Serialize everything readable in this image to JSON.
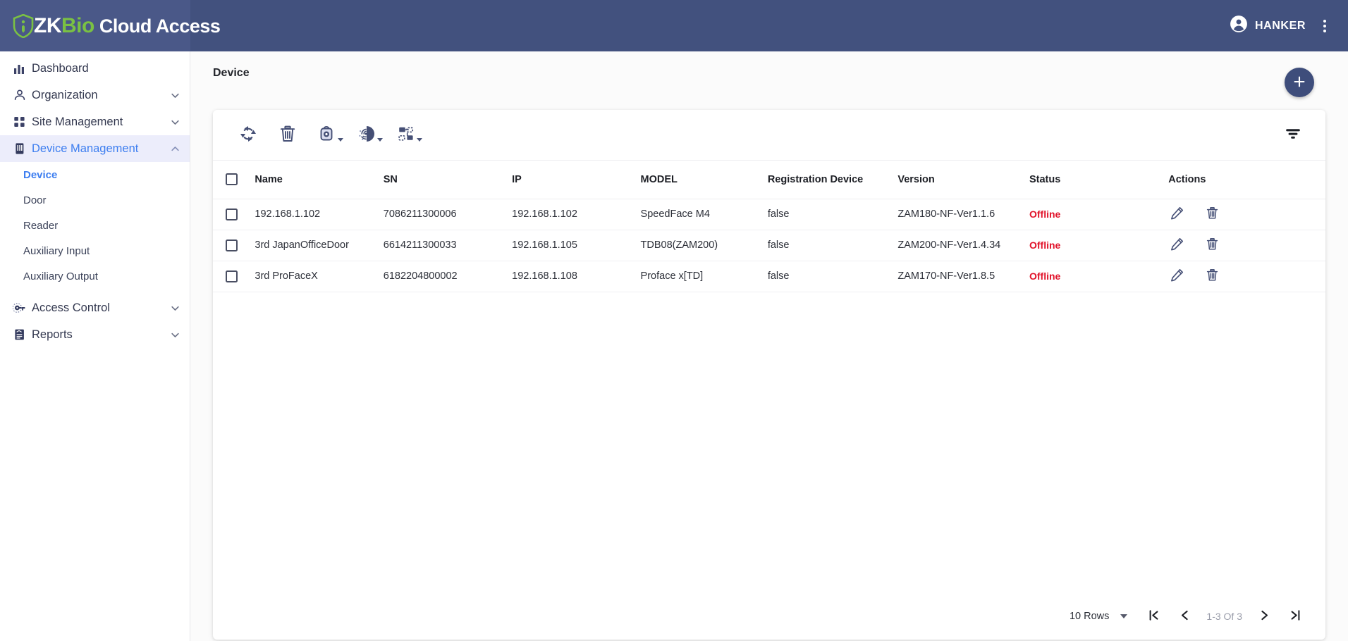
{
  "app": {
    "brand_zk": "ZK",
    "brand_bio": "Bio",
    "brand_product": "Cloud Access",
    "user_name": "HANKER"
  },
  "sidebar": {
    "items": [
      {
        "label": "Dashboard",
        "icon": "bar-chart-icon",
        "expandable": false,
        "active": false
      },
      {
        "label": "Organization",
        "icon": "person-icon",
        "expandable": true,
        "active": false
      },
      {
        "label": "Site Management",
        "icon": "grid-blocks-icon",
        "expandable": true,
        "active": false
      },
      {
        "label": "Device Management",
        "icon": "device-rack-icon",
        "expandable": true,
        "active": true
      },
      {
        "label": "Access Control",
        "icon": "key-icon",
        "expandable": true,
        "active": false
      },
      {
        "label": "Reports",
        "icon": "report-document-icon",
        "expandable": true,
        "active": false
      }
    ],
    "sub_items": [
      {
        "label": "Device",
        "active": true
      },
      {
        "label": "Door",
        "active": false
      },
      {
        "label": "Reader",
        "active": false
      },
      {
        "label": "Auxiliary Input",
        "active": false
      },
      {
        "label": "Auxiliary Output",
        "active": false
      }
    ]
  },
  "page": {
    "title": "Device",
    "add_button_label": "+"
  },
  "toolbar": {
    "buttons": [
      {
        "name": "refresh-sync-icon",
        "caret": false
      },
      {
        "name": "delete-trash-icon",
        "caret": false
      },
      {
        "name": "device-capture-icon",
        "caret": true
      },
      {
        "name": "fingerprint-gear-icon",
        "caret": true
      },
      {
        "name": "transfer-data-icon",
        "caret": true
      }
    ],
    "filter_icon": "filter-funnel-icon"
  },
  "table": {
    "columns": [
      "Name",
      "SN",
      "IP",
      "MODEL",
      "Registration Device",
      "Version",
      "Status",
      "Actions"
    ],
    "rows": [
      {
        "name": "192.168.1.102",
        "sn": "7086211300006",
        "ip": "192.168.1.102",
        "model": "SpeedFace M4",
        "registration_device": "false",
        "version": "ZAM180-NF-Ver1.1.6",
        "status": "Offline"
      },
      {
        "name": "3rd JapanOfficeDoor",
        "sn": "6614211300033",
        "ip": "192.168.1.105",
        "model": "TDB08(ZAM200)",
        "registration_device": "false",
        "version": "ZAM200-NF-Ver1.4.34",
        "status": "Offline"
      },
      {
        "name": "3rd ProFaceX",
        "sn": "6182204800002",
        "ip": "192.168.1.108",
        "model": "Proface x[TD]",
        "registration_device": "false",
        "version": "ZAM170-NF-Ver1.8.5",
        "status": "Offline"
      }
    ]
  },
  "pagination": {
    "rows_per_page": "10 Rows",
    "range": "1-3 Of 3",
    "first_icon": "first-page-icon",
    "prev_icon": "prev-page-icon",
    "next_icon": "next-page-icon",
    "last_icon": "last-page-icon"
  },
  "colors": {
    "topbar": "#42517e",
    "brand_block": "#4a5888",
    "brand_green": "#7ac143",
    "active_nav_bg": "#ecedfb",
    "active_nav_text": "#3d7ef0",
    "status_offline": "#e1132a",
    "fab": "#3e4d7b",
    "icon_navy": "#454f75"
  }
}
